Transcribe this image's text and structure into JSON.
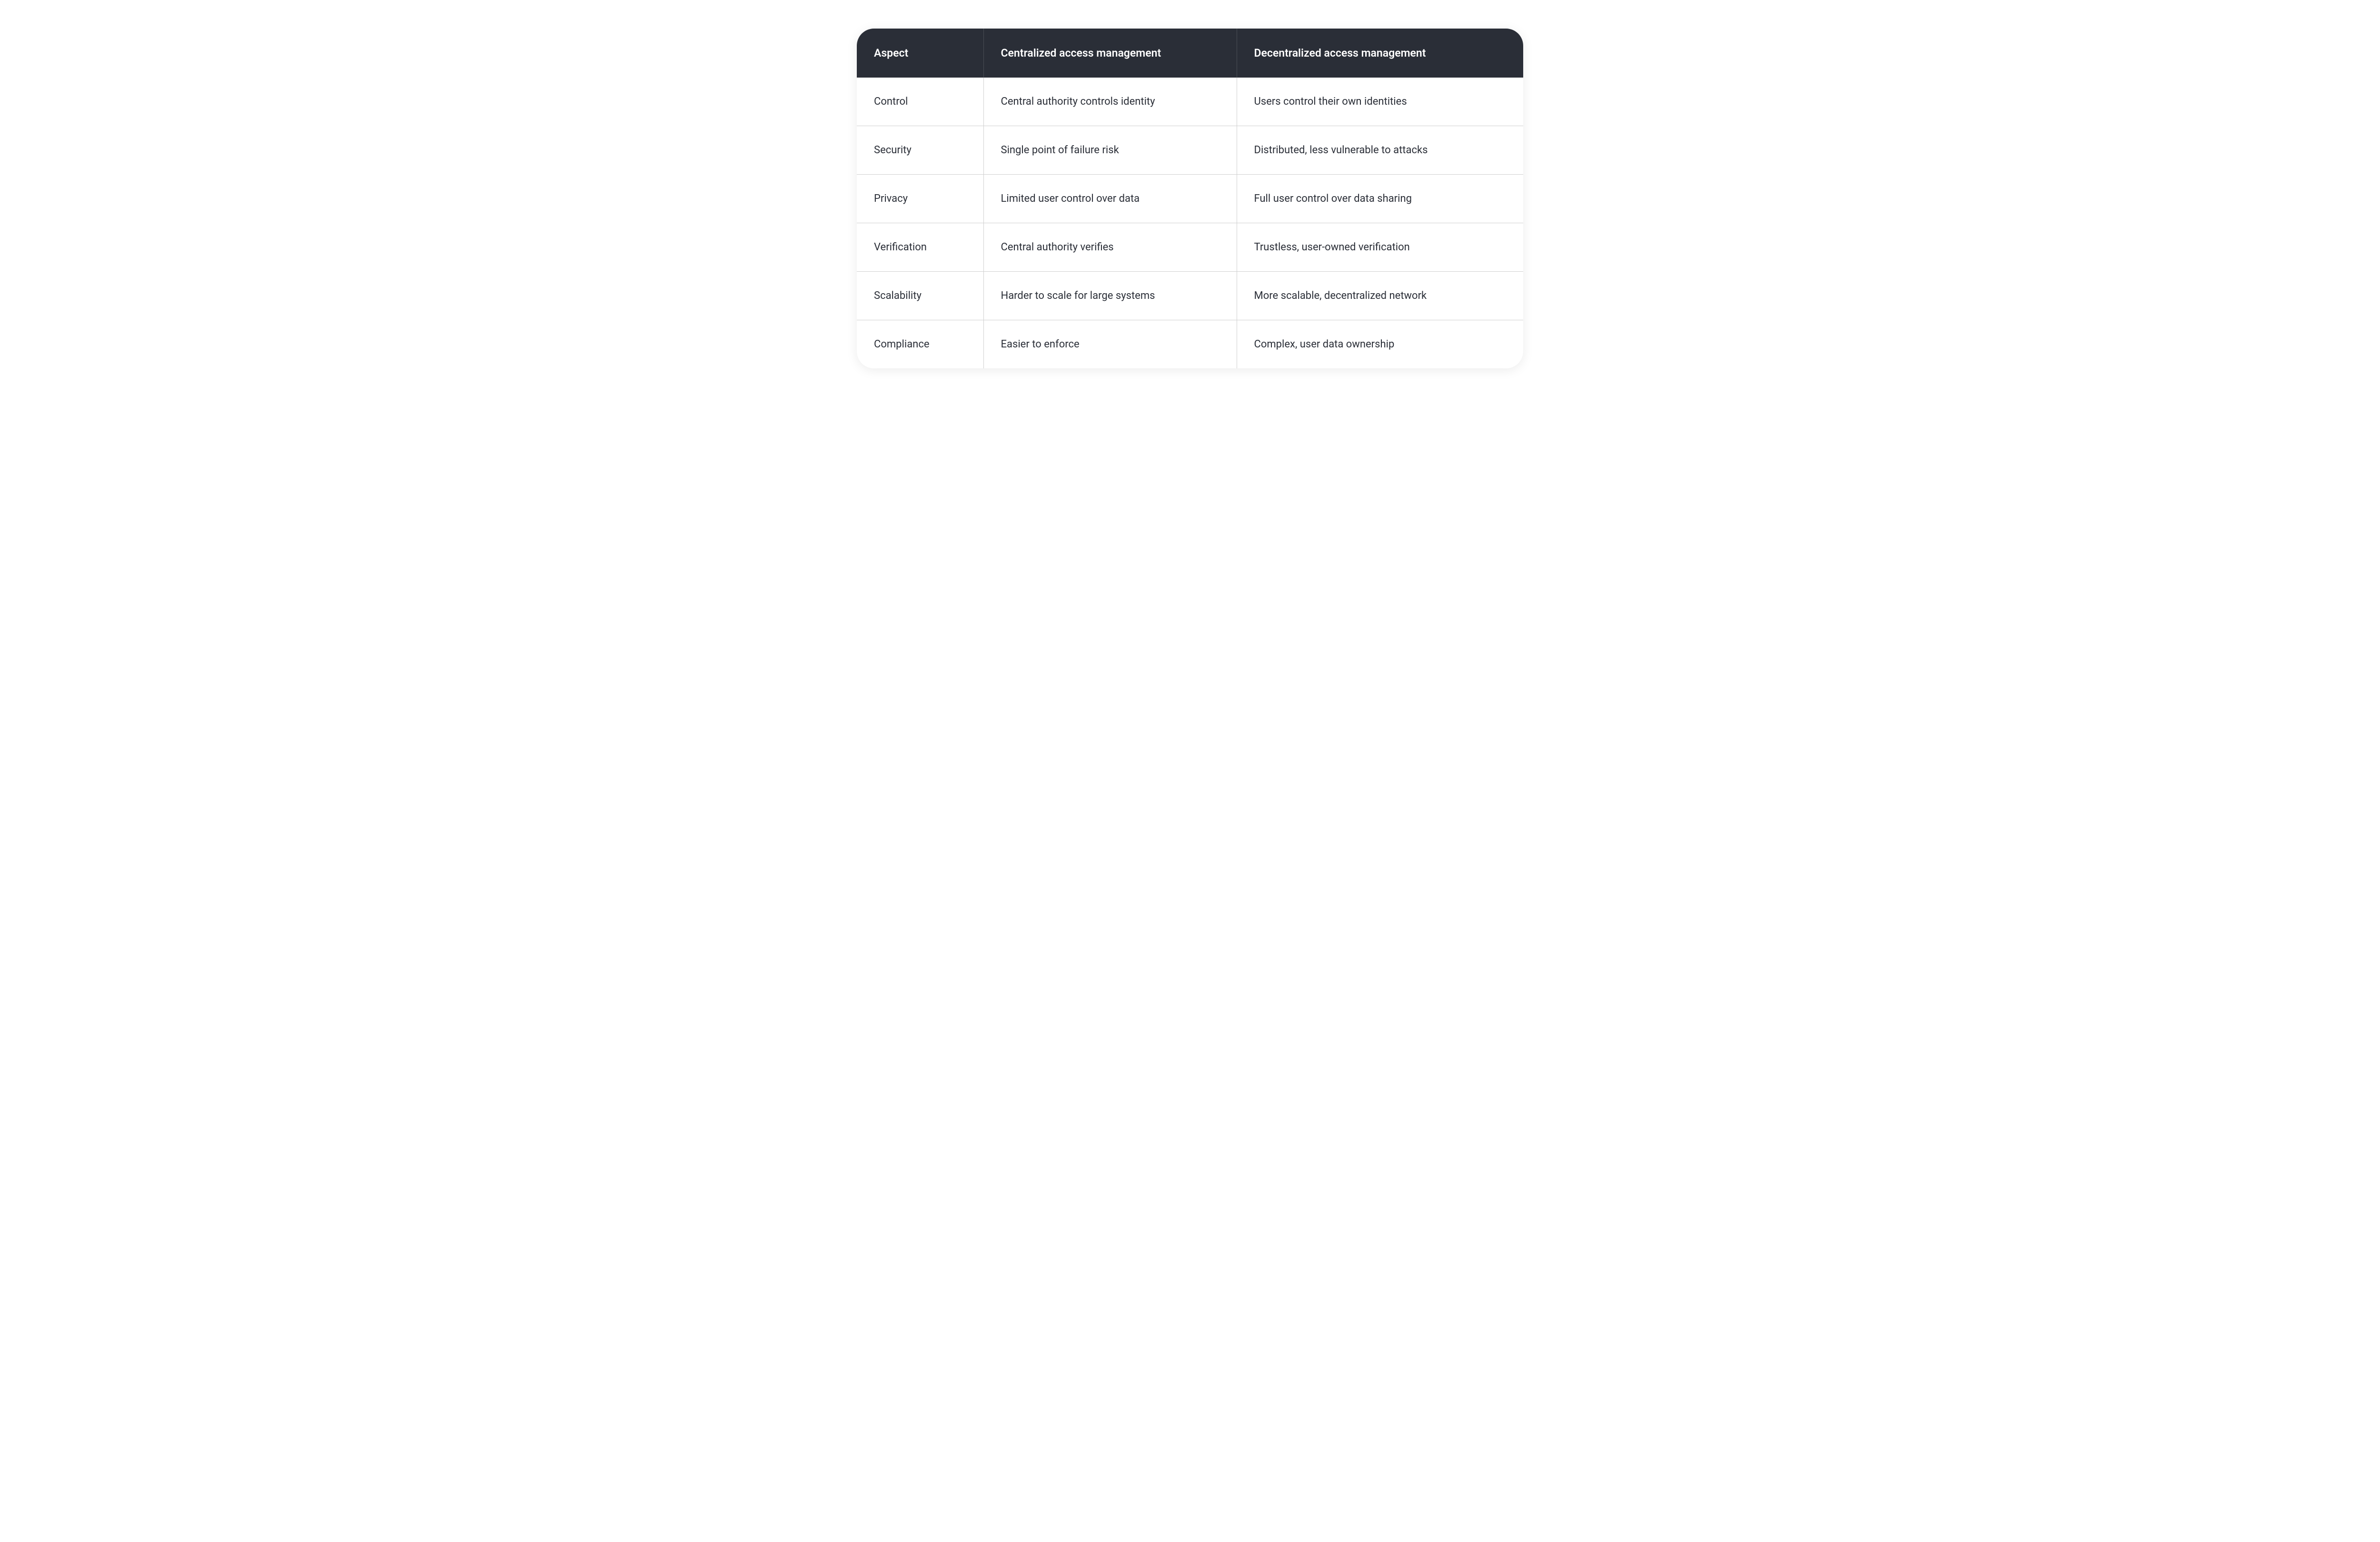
{
  "chart_data": {
    "type": "table",
    "headers": [
      "Aspect",
      "Centralized access management",
      "Decentralized access management"
    ],
    "rows": [
      [
        "Control",
        "Central authority controls identity",
        "Users control their own identities"
      ],
      [
        "Security",
        "Single point of failure risk",
        "Distributed, less vulnerable to attacks"
      ],
      [
        "Privacy",
        "Limited user control over data",
        "Full user control over data sharing"
      ],
      [
        "Verification",
        "Central authority verifies",
        "Trustless, user-owned verification"
      ],
      [
        "Scalability",
        "Harder to scale for large systems",
        "More scalable, decentralized network"
      ],
      [
        "Compliance",
        "Easier to enforce",
        "Complex, user data ownership"
      ]
    ]
  },
  "table": {
    "headers": {
      "col0": "Aspect",
      "col1": "Centralized access management",
      "col2": "Decentralized access management"
    },
    "rows": [
      {
        "col0": "Control",
        "col1": "Central authority controls identity",
        "col2": "Users control their own identities"
      },
      {
        "col0": "Security",
        "col1": "Single point of failure risk",
        "col2": "Distributed, less vulnerable to attacks"
      },
      {
        "col0": "Privacy",
        "col1": "Limited user control over data",
        "col2": "Full user control over data sharing"
      },
      {
        "col0": "Verification",
        "col1": "Central authority verifies",
        "col2": "Trustless, user-owned verification"
      },
      {
        "col0": "Scalability",
        "col1": "Harder to scale for large systems",
        "col2": "More scalable, decentralized network"
      },
      {
        "col0": "Compliance",
        "col1": "Easier to enforce",
        "col2": "Complex, user data ownership"
      }
    ]
  }
}
